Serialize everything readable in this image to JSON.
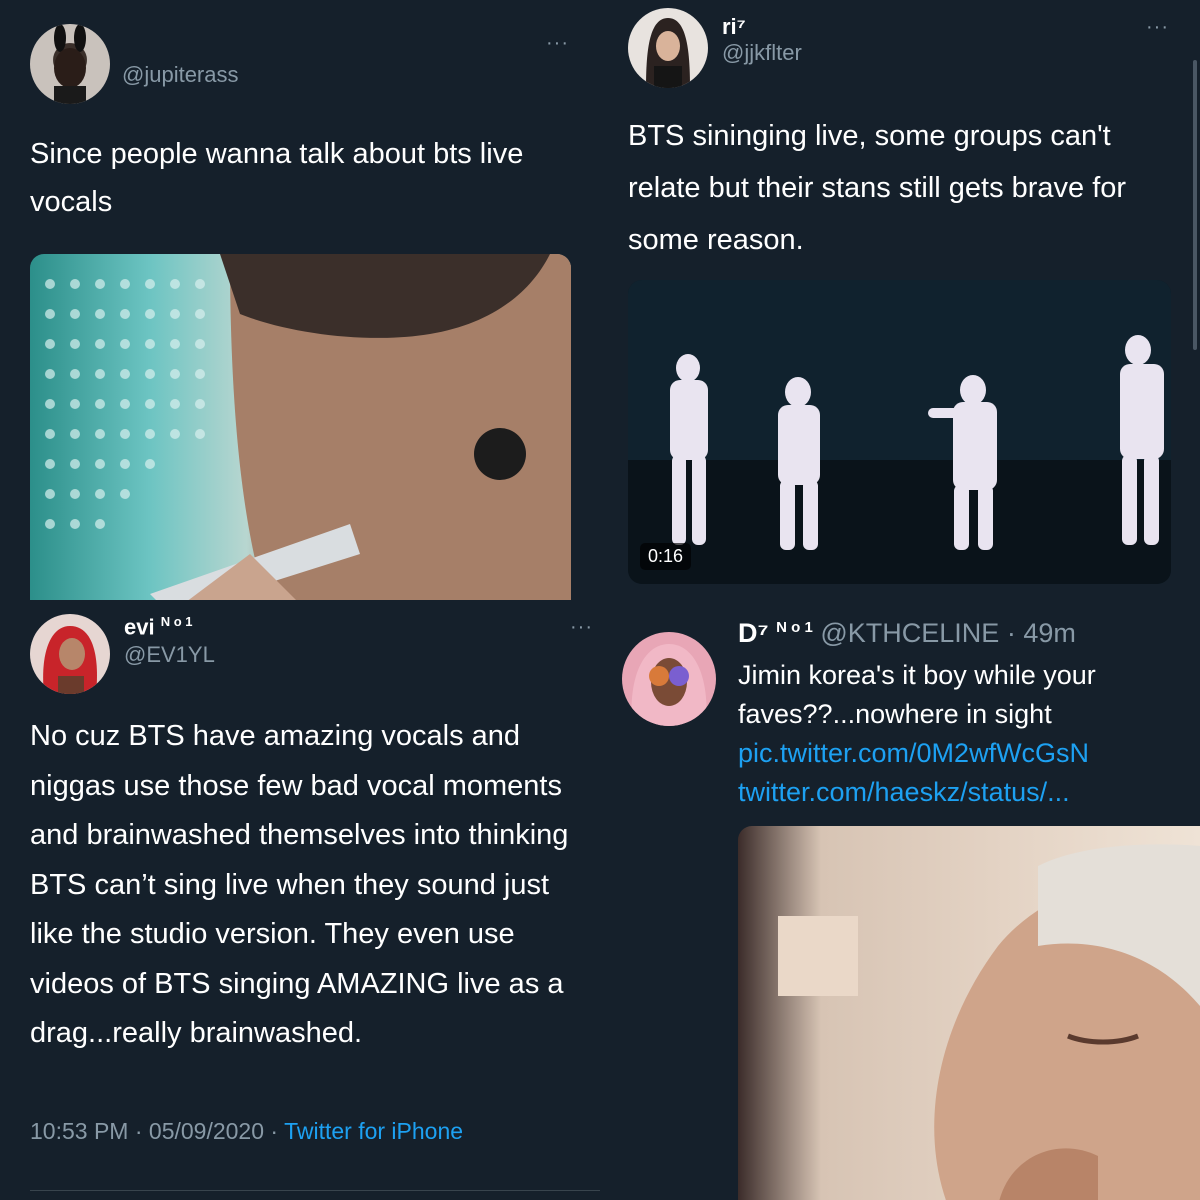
{
  "tweets": [
    {
      "handle": "@jupiterass",
      "more_label": "···",
      "text": "Since people wanna talk about bts live vocals"
    },
    {
      "name": "ri⁷",
      "handle": "@jjkflter",
      "more_label": "···",
      "text": "BTS sininging live, some groups can't relate but their stans still gets brave for some reason.",
      "video_duration": "0:16"
    },
    {
      "name": "evi",
      "name_badge": "N o 1",
      "handle": "@EV1YL",
      "more_label": "···",
      "text": "No cuz BTS have amazing vocals and niggas use those few bad vocal moments and brainwashed themselves into thinking BTS can’t sing live when they sound just like the studio version. They even use videos of BTS singing AMAZING live as a drag...really brainwashed.",
      "time": "10:53 PM",
      "date": "05/09/2020",
      "separator": "·",
      "source": "Twitter for iPhone"
    },
    {
      "name": "D⁷",
      "name_badge": "N o 1",
      "handle": "@KTHCELINE",
      "separator": "·",
      "age": "49m",
      "text": "Jimin korea's it boy while your faves??...nowhere in sight",
      "link1": "pic.twitter.com/0M2wfWcGsN",
      "link2": "twitter.com/haeskz/status/..."
    }
  ]
}
